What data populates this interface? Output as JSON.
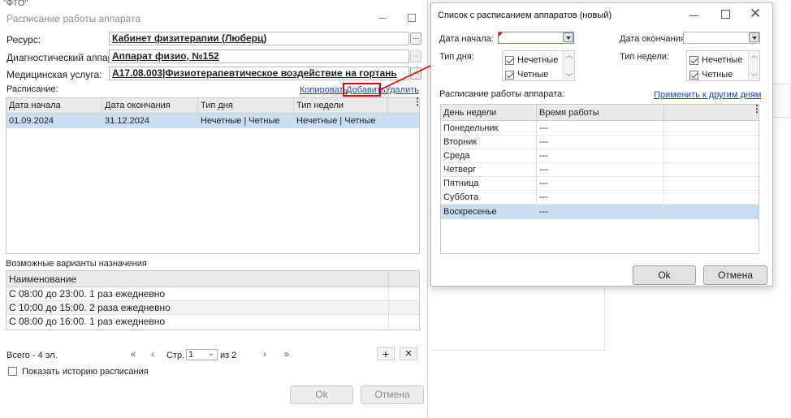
{
  "outer_window": {
    "app_tag": "\"ФТО\"",
    "title": "Расписание работы аппарата",
    "fields": [
      {
        "label": "Ресурс:",
        "value": "Кабинет физитерапии (Люберц)"
      },
      {
        "label": "Диагностический аппарат:",
        "value": "Аппарат физио, №152"
      },
      {
        "label": "Медицинская услуга:",
        "value": "А17.08.003|Физиотерапевтическое воздействие на гортань"
      }
    ],
    "dots_label": "...",
    "schedule_label": "Расписание:",
    "actions": {
      "copy": "Копировать",
      "add": "Добавить",
      "delete": "Удалить"
    },
    "schedule_table": {
      "columns": [
        "Дата начала",
        "Дата окончания",
        "Тип дня",
        "Тип недели"
      ],
      "rows": [
        [
          "01.09.2024",
          "31.12.2024",
          "Нечетные | Четные",
          "Нечетные | Четные"
        ]
      ]
    },
    "variants_label": "Возможные варианты назначения",
    "variants_table": {
      "column": "Наименование",
      "rows": [
        "С 08:00 до 23:00. 1 раз ежедневно",
        "С 10:00 до 15:00. 2 раза ежедневно",
        "С 08:00 до 16:00. 1 раз ежедневно"
      ]
    },
    "pager": {
      "total": "Всего - 4 эл.",
      "page_label": "Стр.",
      "page_value": "1",
      "of_label": "из 2",
      "first": "«",
      "prev": "‹",
      "next": "›",
      "last": "»",
      "add": "+",
      "remove": "✕"
    },
    "history_checkbox": "Показать историю расписания",
    "ok": "Ok",
    "cancel": "Отмена"
  },
  "dialog": {
    "title": "Список с расписанием аппаратов (новый)",
    "start_label": "Дата начала:",
    "end_label": "Дата окончания:",
    "day_type_label": "Тип дня:",
    "week_type_label": "Тип недели:",
    "day_types": [
      "Нечетные",
      "Четные"
    ],
    "week_types": [
      "Нечетные",
      "Четные"
    ],
    "schedule_label": "Расписание работы аппарата:",
    "apply_link": "Применить к другим дням",
    "columns": [
      "День недели",
      "Время работы"
    ],
    "rows": [
      {
        "day": "Понедельник",
        "time": "---"
      },
      {
        "day": "Вторник",
        "time": "---"
      },
      {
        "day": "Среда",
        "time": "---"
      },
      {
        "day": "Четверг",
        "time": "---"
      },
      {
        "day": "Пятница",
        "time": "---"
      },
      {
        "day": "Суббота",
        "time": "---"
      },
      {
        "day": "Воскресенье",
        "time": "---"
      }
    ],
    "ok": "Ok",
    "cancel": "Отмена"
  },
  "colors": {
    "selection": "#c8dcf2",
    "highlight_box": "#e00000",
    "arrow": "#e00000",
    "link": "#1a44c8"
  }
}
